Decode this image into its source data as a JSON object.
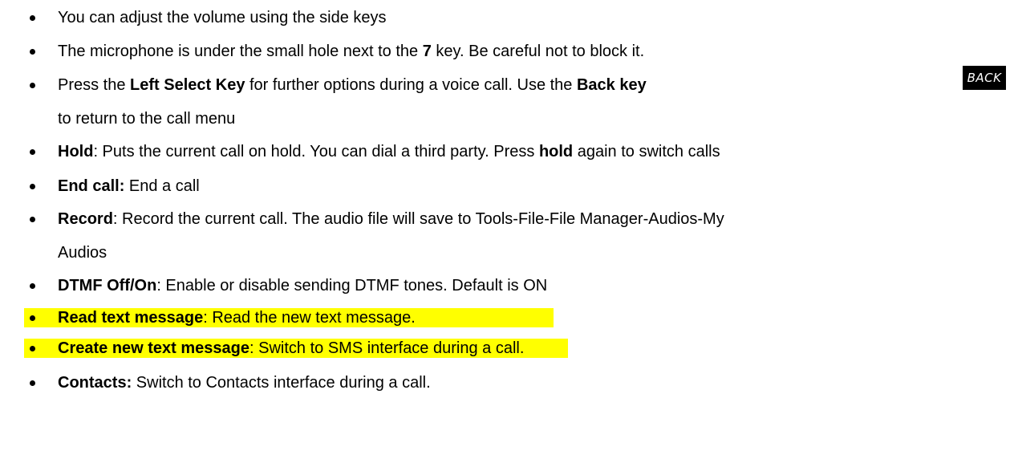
{
  "items": [
    {
      "text": "You can adjust the volume using the side keys"
    },
    {
      "pre": "The microphone is under the small hole next to the ",
      "bold": "7",
      "post": " key. Be careful not to block it."
    },
    {
      "pre": "Press the ",
      "bold1": "Left Select Key",
      "mid": " for further options during a voice call. Use the ",
      "bold2": "Back key",
      "line2": "to return to the call menu"
    },
    {
      "bold": "Hold",
      "post": ": Puts the current call on hold. You can dial a third party. Press ",
      "bold2": "hold",
      "post2": " again to switch calls"
    },
    {
      "bold": "End call:",
      "post": " End a call"
    },
    {
      "bold": "Record",
      "post": ": Record the current call. The audio file will save to Tools-File-File Manager-Audios-My",
      "line2": "Audios"
    },
    {
      "bold": "DTMF Off/On",
      "post": ": Enable or disable sending DTMF tones. Default is ON"
    },
    {
      "bold": "Read text message",
      "post": ": Read the new text message."
    },
    {
      "bold": "Create new text message",
      "post": ": Switch to SMS interface during a call."
    },
    {
      "bold": "Contacts:",
      "post": " Switch to Contacts interface during a call."
    }
  ],
  "back_key_icon": {
    "label": "BACK",
    "icon": "back-key-icon"
  },
  "highlight_color": "#ffff00"
}
